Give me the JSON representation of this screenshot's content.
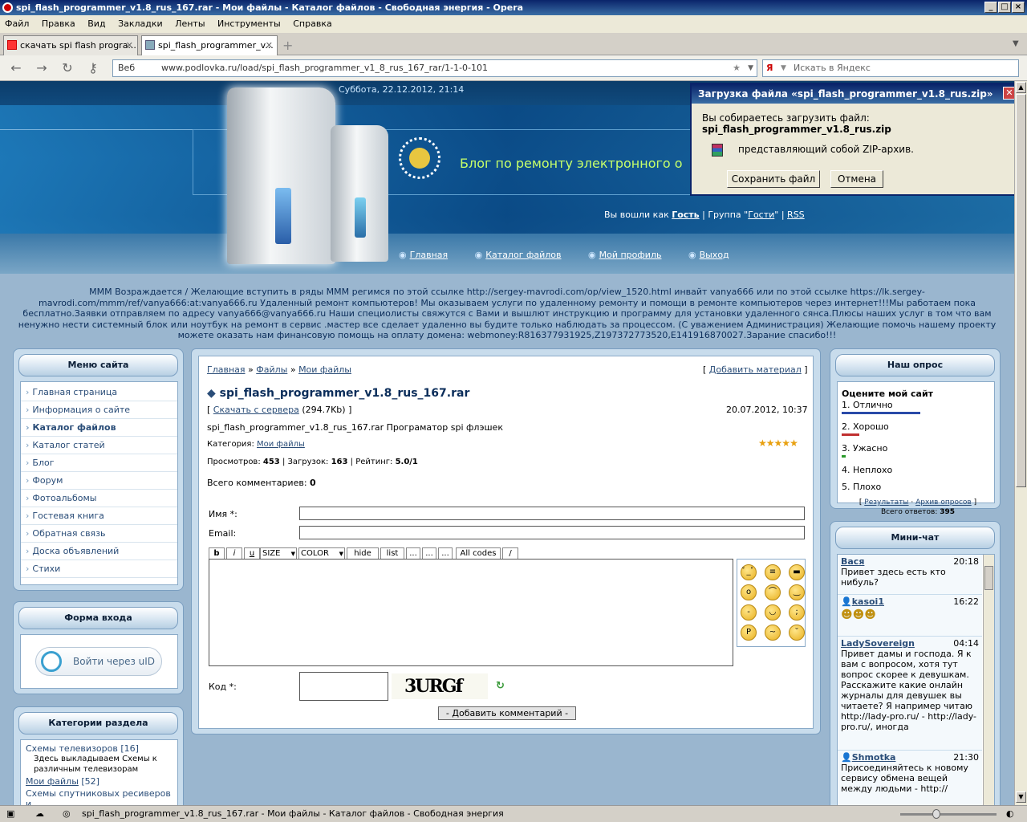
{
  "window": {
    "title": "spi_flash_programmer_v1.8_rus_167.rar - Мои файлы - Каталог файлов - Свободная энергия - Opera"
  },
  "menu": [
    "Файл",
    "Правка",
    "Вид",
    "Закладки",
    "Ленты",
    "Инструменты",
    "Справка"
  ],
  "tabs": [
    {
      "label": "скачать spi flash progra...",
      "active": false
    },
    {
      "label": "spi_flash_programmer_v...",
      "active": true
    }
  ],
  "address": {
    "web_label": "Веб",
    "url": "www.podlovka.ru/load/spi_flash_programmer_v1_8_rus_167_rar/1-1-0-101",
    "search_placeholder": "Искать в Яндекс"
  },
  "header": {
    "date": "Суббота, 22.12.2012, 21:14",
    "blog_title": "Блог по ремонту электронного  о",
    "logged_in_prefix": "Вы вошли как",
    "user": "Гость",
    "group_prefix": "| Группа \"",
    "group": "Гости",
    "group_suffix": "\" |",
    "rss": "RSS",
    "nav": [
      "Главная",
      "Каталог файлов",
      "Мой профиль",
      "Выход"
    ]
  },
  "marquee": "МММ Возраждается / Желающие вступить в ряды МММ регимся по этой ссылке http://sergey-mavrodi.com/op/view_1520.html инвайт vanya666 или по этой ссылке https://lk.sergey-mavrodi.com/mmm/ref/vanya666:at:vanya666.ru Удаленный ремонт компьютеров! Мы оказываем услуги по удаленному ремонту и помощи в ремонте компьютеров через интернет!!!Мы работаем пока бесплатно.Заявки отправляем по адресу vanya666@vanya666.ru Наши специолисты свяжутся с Вами и вышлют инструкцию и программу для установки удаленного сянса.Плюсы наших услуг в том что вам ненужно нести системный блок или ноутбук на ремонт в сервис .мастер все сделает удаленно вы будите только наблюдать за процессом. (С уважением Администрация) Желающие помочь нашему проекту можете оказать нам финансовую помощь на оплату домена: webmoney:R816377931925,Z197372773520,E141916870027.Зарание спасибо!!!",
  "site_menu": {
    "title": "Меню сайта",
    "items": [
      "Главная страница",
      "Информация о сайте",
      "Каталог файлов",
      "Каталог статей",
      "Блог",
      "Форум",
      "Фотоальбомы",
      "Гостевая книга",
      "Обратная связь",
      "Доска объявлений",
      "Стихи"
    ]
  },
  "login_form": {
    "title": "Форма входа",
    "uid_button": "Войти через uID"
  },
  "categories": {
    "title": "Категории раздела",
    "items": [
      {
        "name": "Схемы телевизоров",
        "count": "[16]",
        "desc": "Здесь выкладываем Схемы к различным телевизорам"
      },
      {
        "name": "Мои файлы",
        "count": "[52]",
        "desc": ""
      },
      {
        "name": "Схемы спутниковых ресиверов и",
        "count": "",
        "desc": ""
      }
    ]
  },
  "main": {
    "breadcrumb": [
      "Главная",
      "Файлы",
      "Мои файлы"
    ],
    "add_material": "Добавить материал",
    "file_title": "spi_flash_programmer_v1.8_rus_167.rar",
    "download_label": "Скачать с сервера",
    "size": "(294.7Kb)",
    "date": "20.07.2012, 10:37",
    "description": "spi_flash_programmer_v1.8_rus_167.rar Програматор spi флэшек",
    "category_label": "Категория:",
    "category": "Мои файлы",
    "views_label": "Просмотров:",
    "views": "453",
    "downloads_label": "Загрузок:",
    "downloads": "163",
    "rating_label": "Рейтинг:",
    "rating": "5.0/1",
    "rating_stars": 5,
    "comments_label": "Всего комментариев:",
    "comments": "0",
    "name_label": "Имя *:",
    "email_label": "Email:",
    "code_label": "Код *:",
    "editor_buttons": [
      "b",
      "i",
      "u",
      "SIZE",
      "COLOR",
      "hide",
      "list",
      "...",
      "...",
      "...",
      "All codes",
      "/"
    ],
    "captcha": "3URGf",
    "submit": "- Добавить комментарий -"
  },
  "poll": {
    "title": "Наш опрос",
    "question": "Оцените мой сайт",
    "options": [
      "1. Отлично",
      "2. Хорошо",
      "3. Ужасно",
      "4. Неплохо",
      "5. Плохо"
    ],
    "results": "Результаты",
    "archive": "Архив опросов",
    "total_label": "Всего ответов:",
    "total": "395"
  },
  "chat": {
    "title": "Мини-чат",
    "messages": [
      {
        "name": "Вася",
        "time": "20:18",
        "text": "Привет здесь есть кто нибуль?"
      },
      {
        "name": "kasoi1",
        "time": "16:22",
        "text": ""
      },
      {
        "name": "LadySovereign",
        "time": "04:14",
        "text": "Привет дамы и господа. Я к вам с вопросом, хотя тут вопрос скорее к девушкам. Расскажите какие онлайн журналы для девушек вы читаете? Я например читаю http://lady-pro.ru/ - http://lady-pro.ru/, иногда"
      },
      {
        "name": "Shmotka",
        "time": "21:30",
        "text": "Присоединяйтесь к новому сервису обмена вещей между людьми - http://"
      }
    ]
  },
  "dialog": {
    "title": "Загрузка файла «spi_flash_programmer_v1.8_rus.zip»",
    "line1": "Вы собираетесь загрузить файл:",
    "filename": "spi_flash_programmer_v1.8_rus.zip",
    "type": "представляющий собой ZIP-архив.",
    "save": "Сохранить файл",
    "cancel": "Отмена"
  },
  "status": {
    "text": "spi_flash_programmer_v1.8_rus_167.rar - Мои файлы - Каталог файлов - Свободная энергия"
  }
}
